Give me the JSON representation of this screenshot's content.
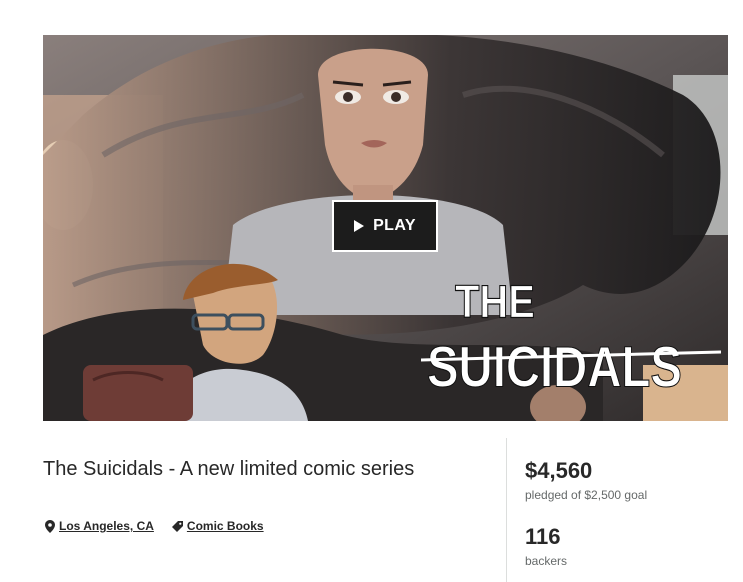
{
  "hero": {
    "play_label": "PLAY",
    "logo_line1": "THE",
    "logo_line2": "SUICIDALS"
  },
  "project": {
    "title": "The Suicidals - A new limited comic series",
    "location": "Los Angeles, CA",
    "category": "Comic Books"
  },
  "stats": {
    "pledged": "$4,560",
    "pledged_label": "pledged of $2,500 goal",
    "backers": "116",
    "backers_label": "backers"
  },
  "icons": {
    "location": "map-pin-icon",
    "category": "tag-icon",
    "play": "play-triangle-icon"
  }
}
